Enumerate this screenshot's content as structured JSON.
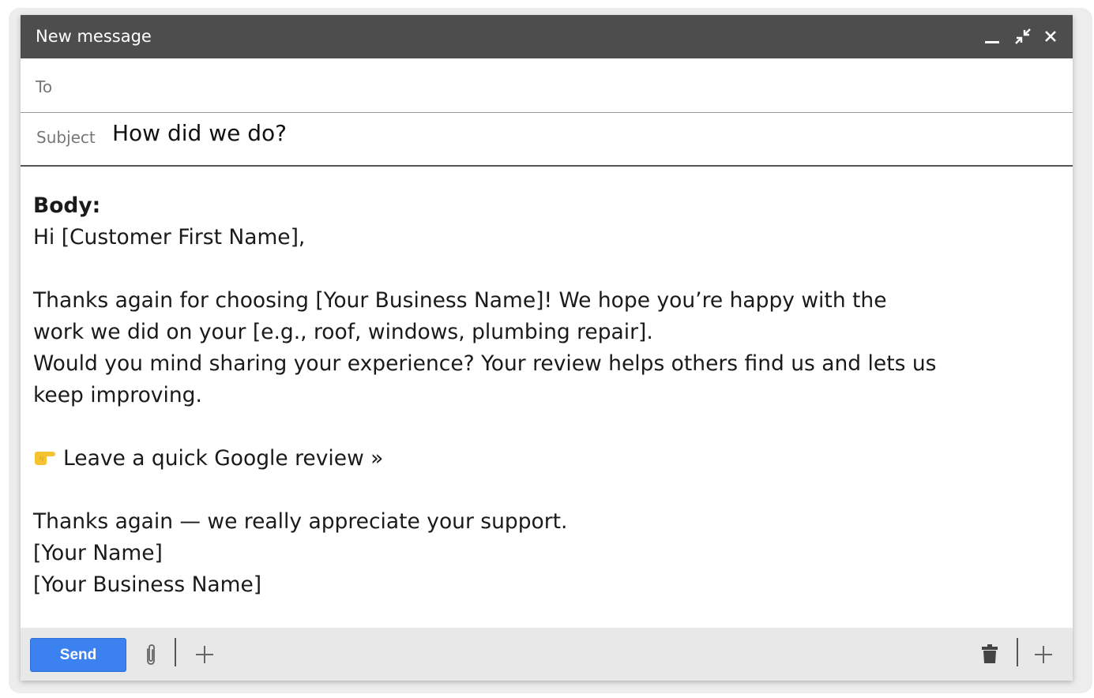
{
  "window": {
    "title": "New message"
  },
  "to": {
    "label": "To",
    "value": ""
  },
  "subject": {
    "label": "Subject",
    "value": "How did we do?"
  },
  "body": {
    "heading": "Body:",
    "greeting": " Hi [Customer First Name],",
    "line1": "Thanks again for choosing [Your Business Name]! We hope you’re happy with the",
    "line2": "work we did on your [e.g., roof, windows, plumbing repair].",
    "line3": "Would you mind sharing your experience? Your review helps others find us and lets us",
    "line4": "keep improving.",
    "review_link": "Leave a quick Google review »",
    "closing": "Thanks again — we really appreciate your support.",
    "sign_name": "[Your Name]",
    "sign_business": "[Your Business Name]"
  },
  "footer": {
    "send_label": "Send"
  },
  "colors": {
    "titlebar": "#4d4d4d",
    "send_button": "#3b82f0",
    "footer": "#e8e8e8"
  },
  "icons": [
    "minimize-icon",
    "exit-fullscreen-icon",
    "close-icon",
    "pointing-hand-icon",
    "paperclip-icon",
    "plus-icon",
    "trash-icon",
    "plus-icon"
  ]
}
